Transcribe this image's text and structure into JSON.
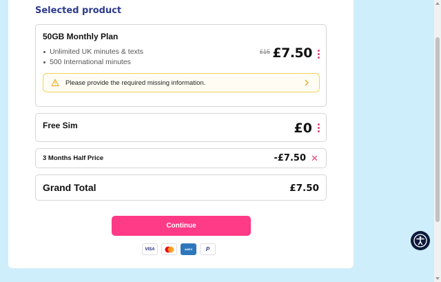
{
  "section_title": "Selected product",
  "plan": {
    "name": "50GB Monthly Plan",
    "features": [
      "Unlimited UK minutes & texts",
      "500 International minutes"
    ],
    "old_price": "£15",
    "price": "£7.50",
    "alert": "Please provide the required missing information."
  },
  "sim": {
    "name": "Free Sim",
    "price": "£0"
  },
  "promo": {
    "name": "3 Months Half Price",
    "amount": "-£7.50",
    "remove_symbol": "✕"
  },
  "total": {
    "label": "Grand Total",
    "value": "£7.50"
  },
  "continue_label": "Continue",
  "payment_methods": [
    "VISA",
    "Mastercard",
    "American Express",
    "PayPal"
  ],
  "payment_labels": {
    "visa": "VISA",
    "amex": "AMEX",
    "paypal": "P"
  },
  "colors": {
    "accent": "#ff3a87",
    "title": "#2d3a8c",
    "background": "#cfeefb",
    "alert_border": "#f2d259"
  }
}
